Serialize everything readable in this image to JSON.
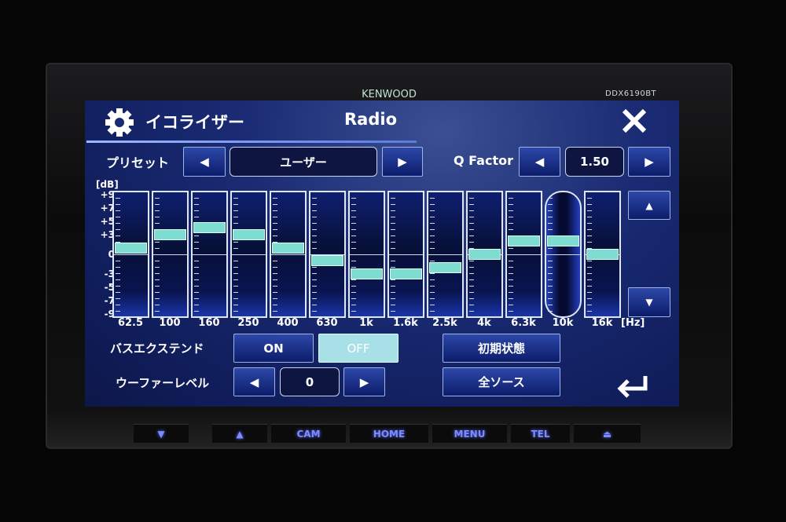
{
  "device": {
    "brand": "KENWOOD",
    "model": "DDX6190BT"
  },
  "header": {
    "icon": "gear-icon",
    "title": "イコライザー",
    "source": "Radio",
    "close_icon": "close-icon"
  },
  "preset": {
    "label": "プリセット",
    "value": "ユーザー",
    "prev": "◀",
    "next": "▶"
  },
  "q_factor": {
    "label": "Q Factor",
    "value": "1.50",
    "prev": "◀",
    "next": "▶"
  },
  "eq": {
    "unit": "[dB]",
    "scale": [
      "+9",
      "+7",
      "+5",
      "+3",
      "0",
      "-3",
      "-5",
      "-7",
      "-9"
    ],
    "hz_unit": "[Hz]",
    "bands": [
      {
        "freq": "62.5",
        "gain": 1
      },
      {
        "freq": "100",
        "gain": 3
      },
      {
        "freq": "160",
        "gain": 4
      },
      {
        "freq": "250",
        "gain": 3
      },
      {
        "freq": "400",
        "gain": 1
      },
      {
        "freq": "630",
        "gain": -1
      },
      {
        "freq": "1k",
        "gain": -3
      },
      {
        "freq": "1.6k",
        "gain": -3
      },
      {
        "freq": "2.5k",
        "gain": -2
      },
      {
        "freq": "4k",
        "gain": 0
      },
      {
        "freq": "6.3k",
        "gain": 2
      },
      {
        "freq": "10k",
        "gain": 2,
        "selected": true
      },
      {
        "freq": "16k",
        "gain": 0
      }
    ],
    "up": "▲",
    "down": "▼"
  },
  "bass_extend": {
    "label": "バスエクステンド",
    "on": "ON",
    "off": "OFF",
    "selected": "OFF"
  },
  "woofer_level": {
    "label": "ウーファーレベル",
    "value": "0",
    "prev": "◀",
    "next": "▶"
  },
  "buttons": {
    "reset": "初期状態",
    "all_sources": "全ソース",
    "back_icon": "back-arrow-icon"
  },
  "hardware": {
    "vol_down": "▼",
    "vol_up": "▲",
    "cam": "CAM",
    "home": "HOME",
    "menu": "MENU",
    "tel": "TEL",
    "eject": "⏏"
  },
  "colors": {
    "screen_bg": "#1a2b74",
    "knob": "#7fdcd0",
    "selected_toggle": "#a8e0e8"
  }
}
